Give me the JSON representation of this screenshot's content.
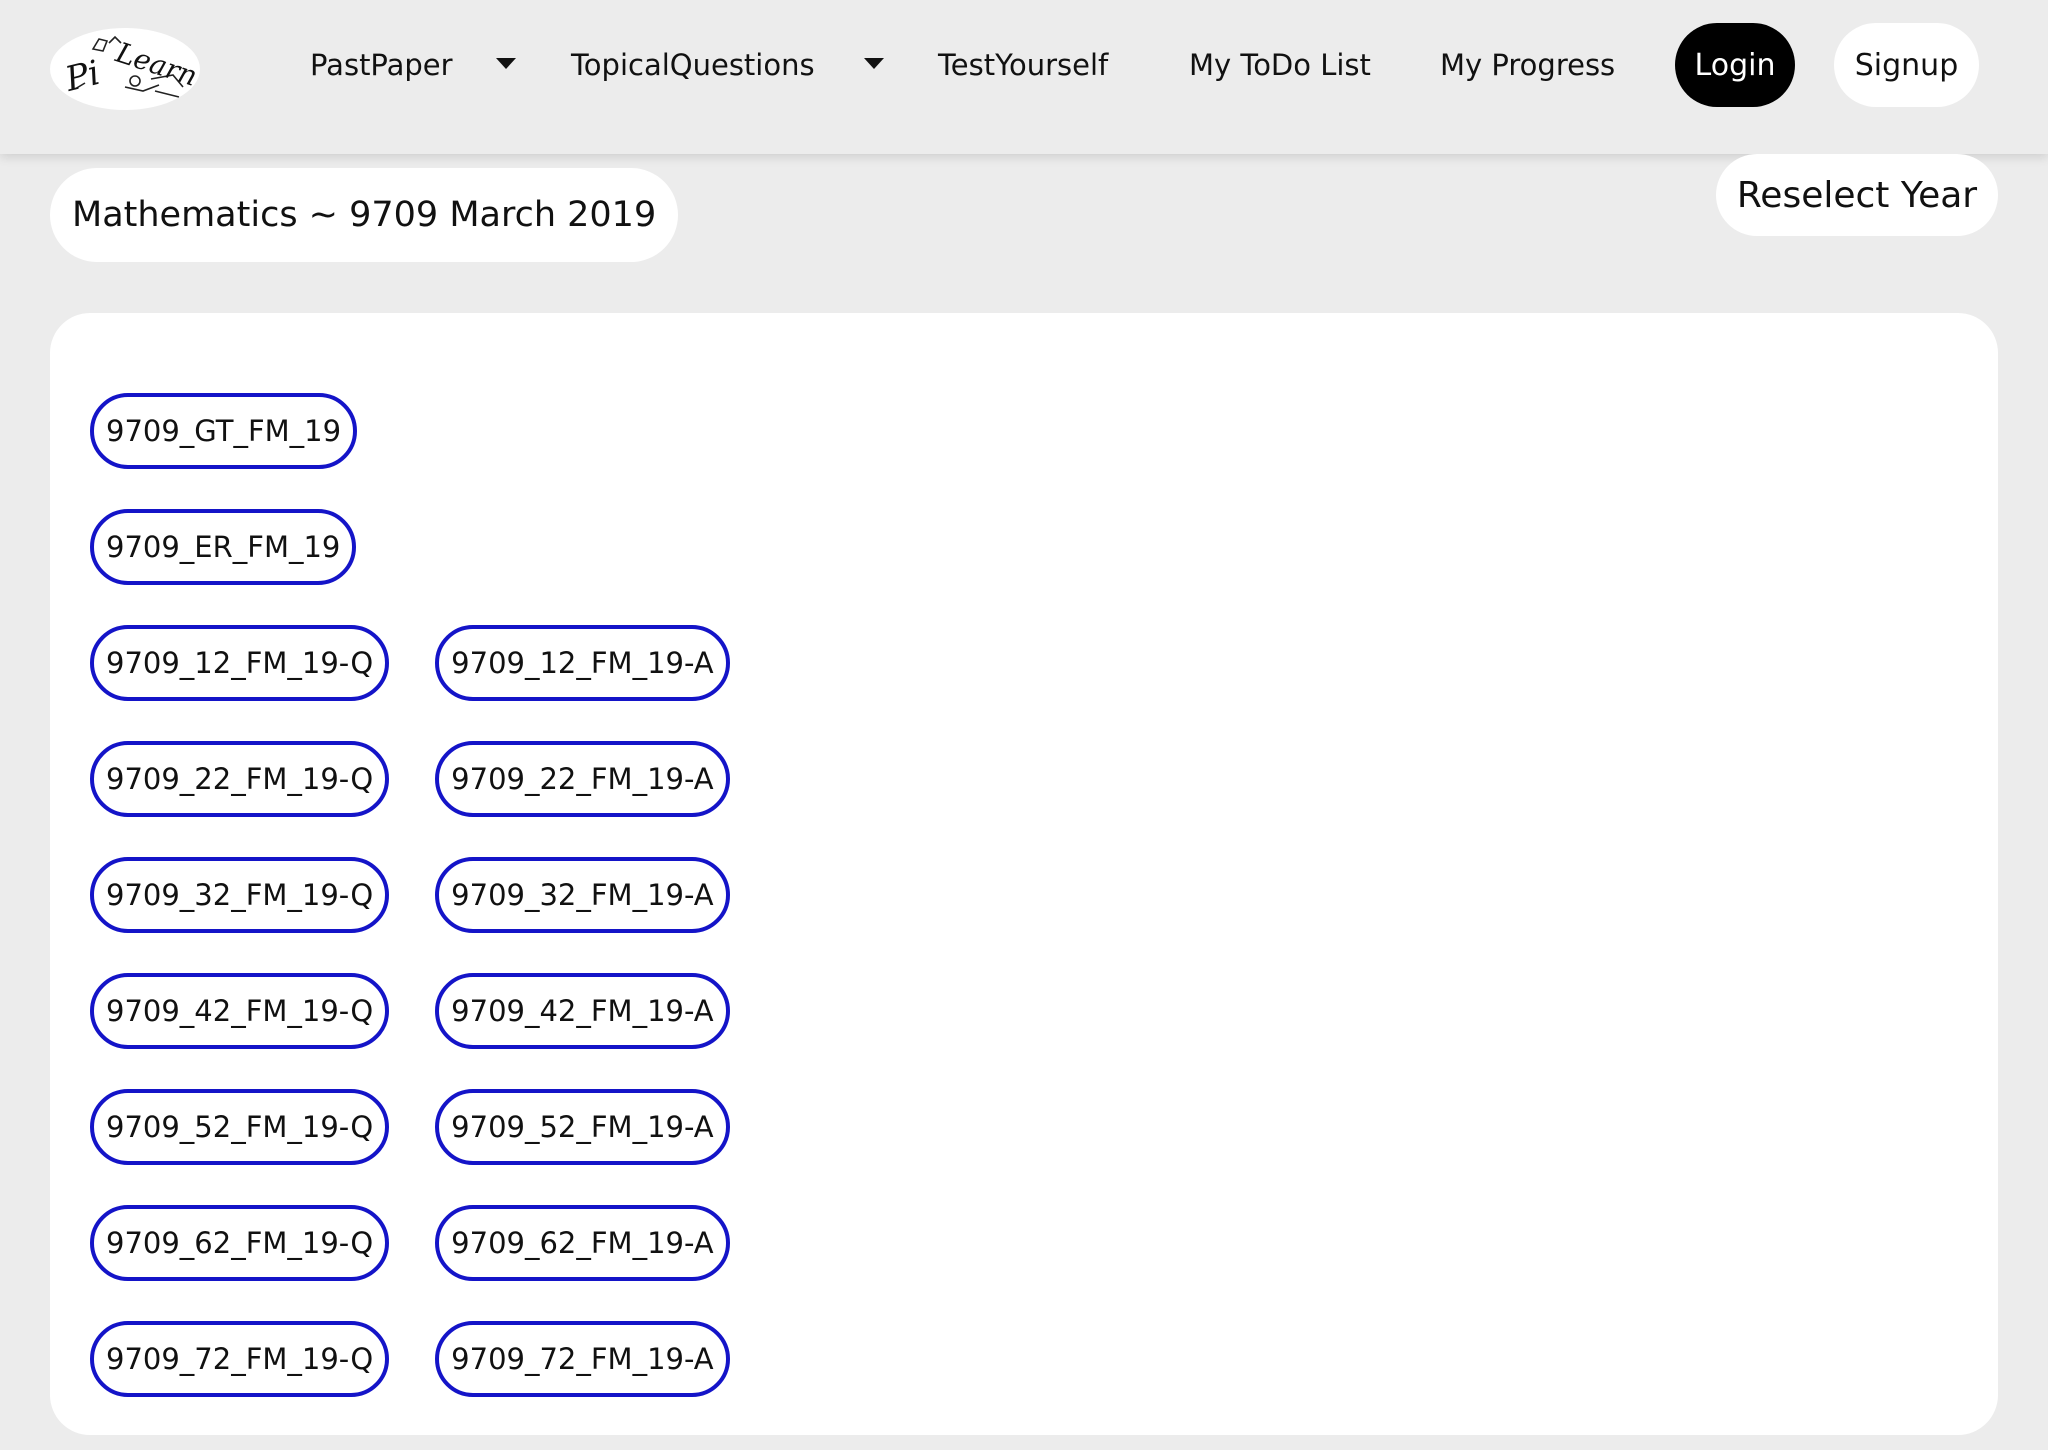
{
  "header": {
    "logo_text": "PiLearn",
    "nav": [
      {
        "label": "PastPaper",
        "has_dropdown": true
      },
      {
        "label": "TopicalQuestions",
        "has_dropdown": true
      },
      {
        "label": "TestYourself",
        "has_dropdown": false
      },
      {
        "label": "My ToDo List",
        "has_dropdown": false
      },
      {
        "label": "My Progress",
        "has_dropdown": false
      }
    ],
    "login_label": "Login",
    "signup_label": "Signup"
  },
  "page": {
    "title": "Mathematics ~ 9709 March 2019",
    "reselect_label": "Reselect Year"
  },
  "files": [
    [
      "9709_GT_FM_19"
    ],
    [
      "9709_ER_FM_19"
    ],
    [
      "9709_12_FM_19-Q",
      "9709_12_FM_19-A"
    ],
    [
      "9709_22_FM_19-Q",
      "9709_22_FM_19-A"
    ],
    [
      "9709_32_FM_19-Q",
      "9709_32_FM_19-A"
    ],
    [
      "9709_42_FM_19-Q",
      "9709_42_FM_19-A"
    ],
    [
      "9709_52_FM_19-Q",
      "9709_52_FM_19-A"
    ],
    [
      "9709_62_FM_19-Q",
      "9709_62_FM_19-A"
    ],
    [
      "9709_72_FM_19-Q",
      "9709_72_FM_19-A"
    ]
  ],
  "colors": {
    "background": "#ececec",
    "pill_border": "#1414c8",
    "login_bg": "#000000"
  }
}
